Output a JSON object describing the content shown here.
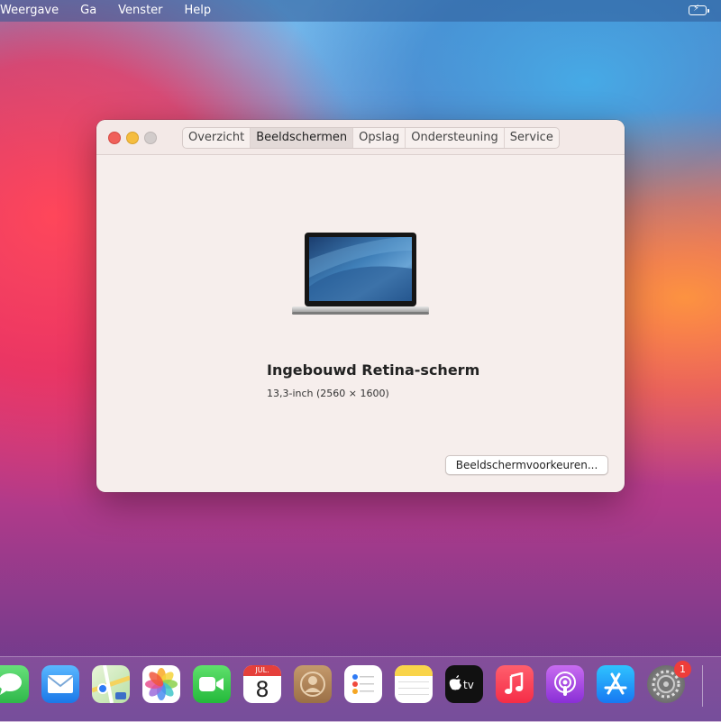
{
  "menubar": {
    "items": [
      "Weergave",
      "Ga",
      "Venster",
      "Help"
    ],
    "battery_icon": "battery-charging-icon"
  },
  "window": {
    "tabs": [
      {
        "label": "Overzicht",
        "active": false
      },
      {
        "label": "Beeldschermen",
        "active": true
      },
      {
        "label": "Opslag",
        "active": false
      },
      {
        "label": "Ondersteuning",
        "active": false
      },
      {
        "label": "Service",
        "active": false
      }
    ],
    "display": {
      "name": "Ingebouwd Retina-scherm",
      "spec": "13,3-inch (2560 × 1600)"
    },
    "button_label": "Beeldschermvoorkeuren..."
  },
  "dock": {
    "calendar_month": "JUL.",
    "calendar_day": "8",
    "settings_badge": "1",
    "icons": [
      "messages-icon",
      "mail-icon",
      "maps-icon",
      "photos-icon",
      "facetime-icon",
      "calendar-icon",
      "contacts-icon",
      "reminders-icon",
      "notes-icon",
      "apple-tv-icon",
      "music-icon",
      "podcasts-icon",
      "app-store-icon",
      "system-preferences-icon"
    ]
  },
  "colors": {
    "accent_close": "#f0605a",
    "accent_minimize": "#f5bd3f",
    "badge": "#ee3d3a"
  }
}
